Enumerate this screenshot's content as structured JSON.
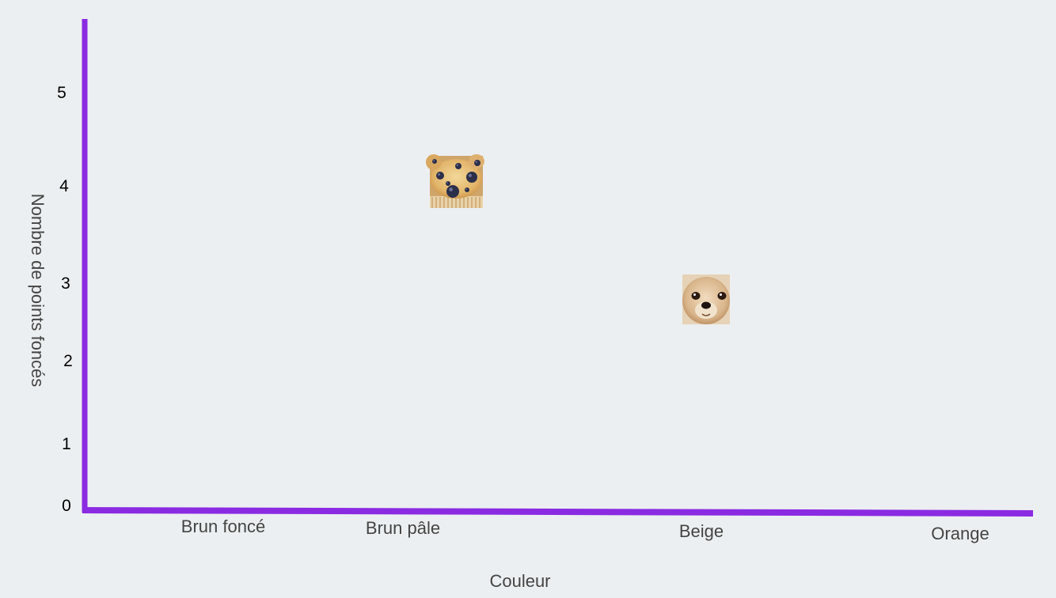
{
  "chart_data": {
    "type": "scatter",
    "title": "",
    "xlabel": "Couleur",
    "ylabel": "Nombre de points foncés",
    "categories": [
      "Brun foncé",
      "Brun pâle",
      "Beige",
      "Orange"
    ],
    "yticks": [
      "0",
      "1",
      "2",
      "3",
      "4",
      "5"
    ],
    "ylim": [
      0,
      5
    ],
    "grid": false,
    "axis_color": "#8A2BE2",
    "points": [
      {
        "category": "Brun pâle",
        "y": 4,
        "icon": "blueberry-muffin"
      },
      {
        "category": "Beige",
        "y": 2.75,
        "icon": "chihuahua-face"
      }
    ]
  }
}
